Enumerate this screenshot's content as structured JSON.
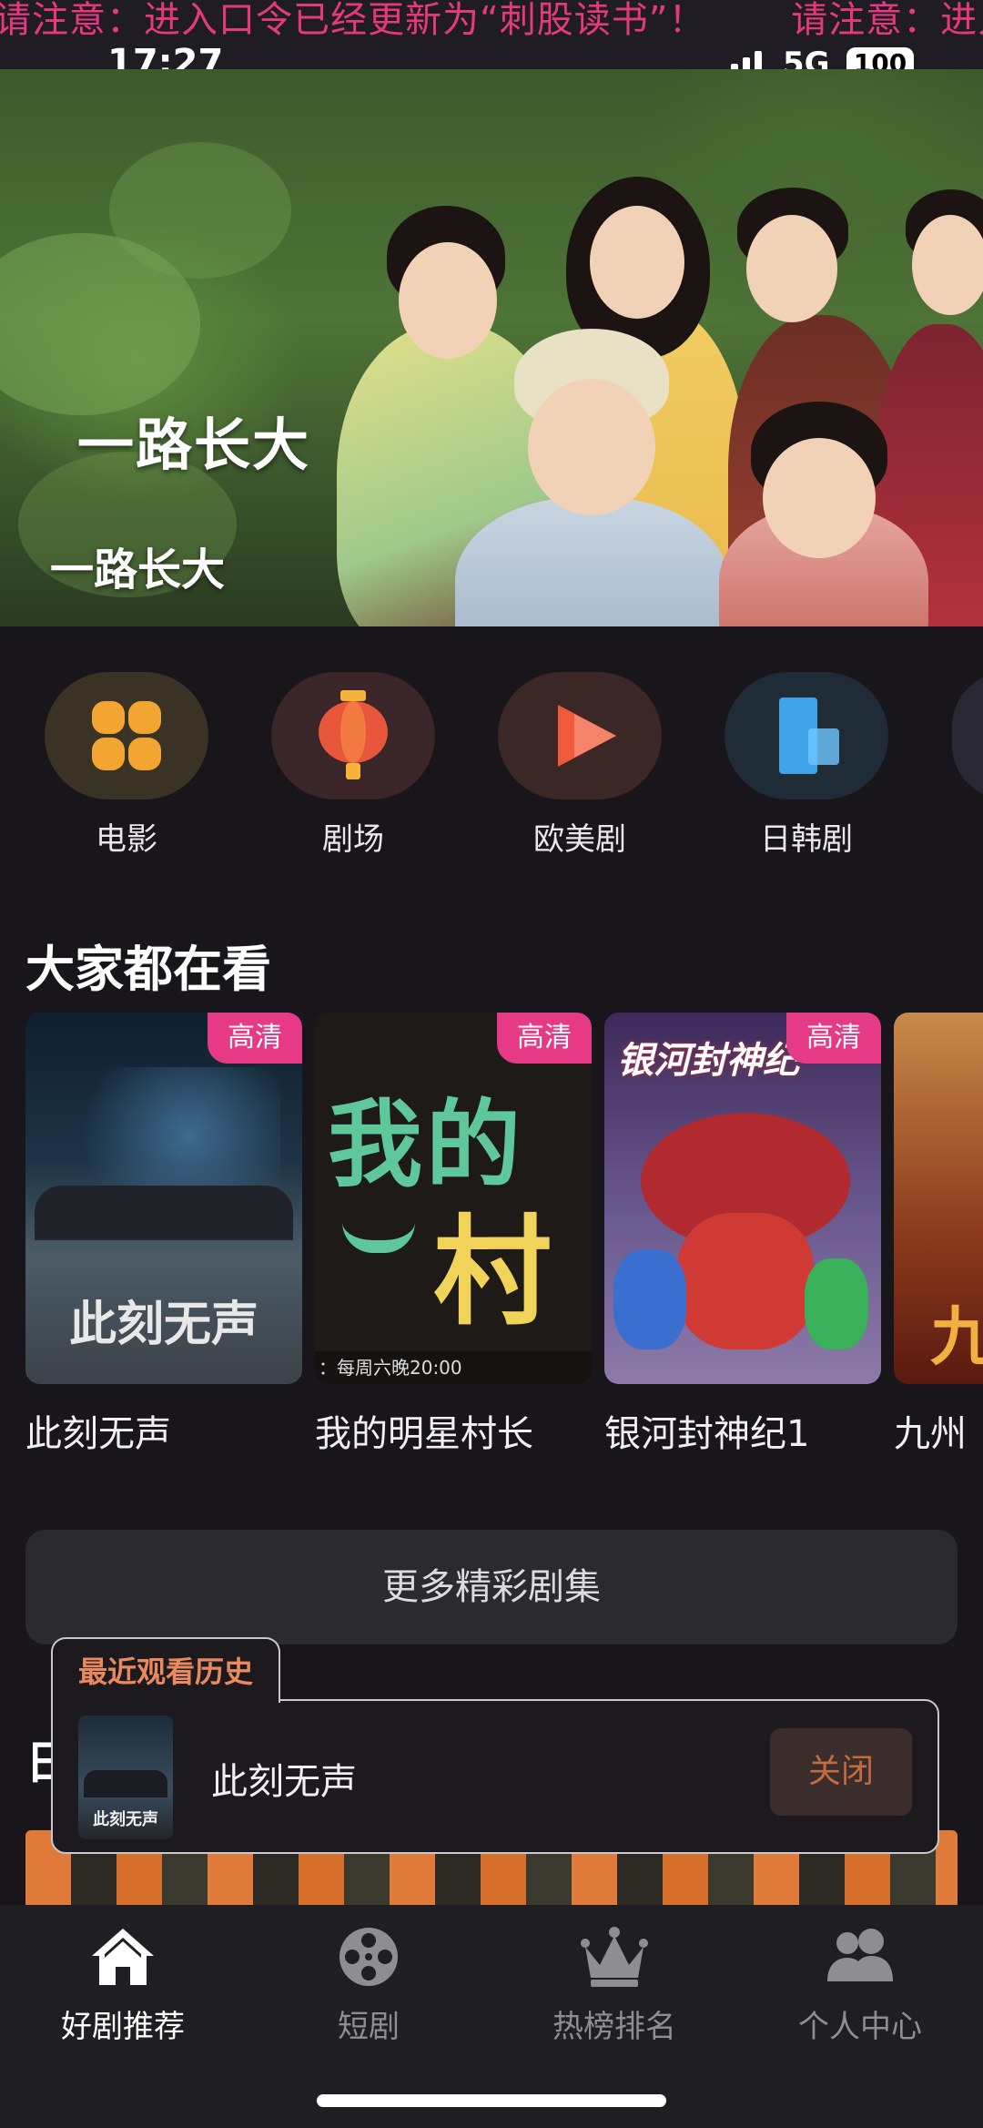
{
  "ticker": {
    "message_1": "请注意：进入口令已经更新为“刺股读书”！",
    "message_2": "请注意：进入口令已经更新为“刺股读书”！"
  },
  "status": {
    "time": "17:27",
    "network": "5G",
    "battery": "100"
  },
  "hero": {
    "logo_text": "一路长大",
    "title": "一路长大"
  },
  "categories": [
    {
      "label": "电影",
      "icon": "movie-flower-icon",
      "color": "#f2a531"
    },
    {
      "label": "剧场",
      "icon": "lantern-icon",
      "color": "#e8573c"
    },
    {
      "label": "欧美剧",
      "icon": "play-triangle-icon",
      "color": "#ef5a3a"
    },
    {
      "label": "日韩剧",
      "icon": "blue-blocks-icon",
      "color": "#3fa3e8"
    }
  ],
  "section": {
    "title": "大家都在看",
    "badge": "高清",
    "cards": [
      {
        "title": "此刻无声",
        "poster_text": "此刻无声",
        "badge": "高清"
      },
      {
        "title": "我的明星村长",
        "poster_text_1": "我的",
        "poster_text_2": "村",
        "poster_caption": "：每周六晚20:00",
        "badge": "高清"
      },
      {
        "title": "银河封神纪1",
        "poster_text": "银河封神纪",
        "badge": "高清"
      },
      {
        "title": "九州",
        "poster_text": "九"
      }
    ]
  },
  "more_button": "更多精彩剧集",
  "history": {
    "tab_label": "最近观看历史",
    "item_title": "此刻无声",
    "thumb_text": "此刻无声",
    "close_label": "关闭"
  },
  "behind_section_initial": "日",
  "bottom_nav": [
    {
      "label": "好剧推荐",
      "icon": "home-icon",
      "active": true
    },
    {
      "label": "短剧",
      "icon": "film-reel-icon",
      "active": false
    },
    {
      "label": "热榜排名",
      "icon": "crown-icon",
      "active": false
    },
    {
      "label": "个人中心",
      "icon": "users-icon",
      "active": false
    }
  ],
  "colors": {
    "accent_pink": "#e73a86",
    "ticker_pink": "#e4397f",
    "history_orange": "#e88a5d",
    "background": "#18161b"
  }
}
